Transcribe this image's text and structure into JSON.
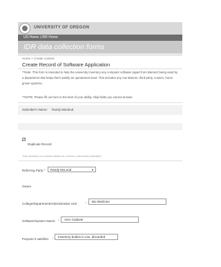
{
  "header": {
    "university": "UNIVERSITY OF OREGON",
    "nav": "UO Home | IDR Home",
    "banner": "IDR data collection forms"
  },
  "page": {
    "breadcrumb": "Home > Create content",
    "title": "Create Record of Software Application",
    "note1": "**Note: This form is intended to help the university inventory any computer software (apart from Banner) being used by a department that helps them satisfy an operational need. This includes any non-Banner, third-party, custom, home grown systems.",
    "note2": "**NOTE: Please fill out form to the best of your ability. Skip fields you cannot answer."
  },
  "form": {
    "submitter_label": "Submitter's Name:",
    "submitter_value": "Randy Macleod",
    "duplicate_label": "Duplicate Record",
    "duplicate_checked": "✓",
    "duplicate_hint": "This checkbox is a review marker for a record I previously submitted",
    "referring_label": "Referring Party:",
    "referring_required": "*",
    "referring_value": "Randy McLeod",
    "owner_label": "Owner",
    "college_label": "College/Department/Administrative Unit:",
    "college_required": "*",
    "college_value": "Bio Medicine",
    "software_label": "Software/System Name:",
    "software_required": "*",
    "software_value": "Aero Cadaver",
    "purpose_label": "Purpose it satisfies:",
    "purpose_required": "*",
    "purpose_value": "Inventory bodies in use, discarded"
  }
}
